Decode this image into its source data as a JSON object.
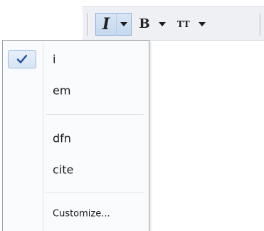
{
  "toolbar": {
    "italic_glyph": "I",
    "bold_glyph": "B",
    "teletype_glyph": "TT"
  },
  "menu": {
    "items": [
      {
        "label": "i",
        "checked": true
      },
      {
        "label": "em"
      },
      {
        "label": "dfn"
      },
      {
        "label": "cite"
      },
      {
        "label": "Customize..."
      }
    ]
  },
  "colors": {
    "active_fill": "#c9dcf1",
    "active_border": "#8fb1d8",
    "checkmark": "#1f4f9c",
    "toolbar_bg": "#eef0f4"
  },
  "icons": {
    "check": "check-icon",
    "dropdown": "chevron-down-icon"
  }
}
